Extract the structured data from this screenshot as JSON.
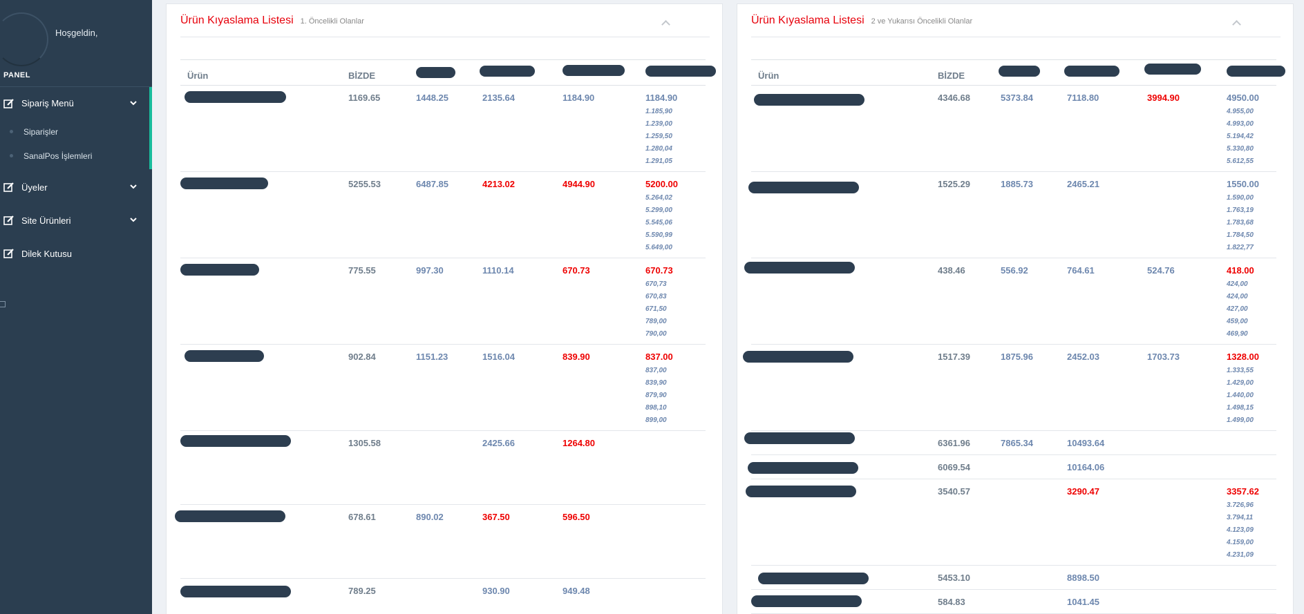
{
  "sidebar": {
    "welcome": "Hoşgeldin,",
    "panel_label": "PANEL",
    "menu": [
      {
        "label": "Sipariş Menü",
        "icon": "edit-icon",
        "has_chevron": true,
        "children": [
          "Siparişler",
          "SanalPos İşlemleri"
        ]
      },
      {
        "label": "Üyeler",
        "icon": "edit-icon",
        "has_chevron": true
      },
      {
        "label": "Site Ürünleri",
        "icon": "edit-icon",
        "has_chevron": true
      },
      {
        "label": "Dilek Kutusu",
        "icon": "edit-icon",
        "has_chevron": false
      }
    ]
  },
  "left_panel": {
    "title": "Ürün Kıyaslama Listesi",
    "subtitle": "1. Öncelikli Olanlar",
    "columns": [
      "Ürün",
      "BİZDE",
      "",
      "",
      "",
      ""
    ],
    "rows": [
      {
        "bizde": "1169.65",
        "c1": "1448.25",
        "c2": "2135.64",
        "c3": "1184.90",
        "c3_red": false,
        "c4": "1184.90",
        "c4_red": false,
        "offers": [
          "1.185,90",
          "1.239,00",
          "1.259,50",
          "1.280,04",
          "1.291,05"
        ]
      },
      {
        "bizde": "5255.53",
        "c1": "6487.85",
        "c2": "4213.02",
        "c2_red": true,
        "c3": "4944.90",
        "c3_red": true,
        "c4": "5200.00",
        "c4_red": true,
        "offers": [
          "5.264,02",
          "5.299,00",
          "5.545,06",
          "5.590,99",
          "5.649,00"
        ]
      },
      {
        "bizde": "775.55",
        "c1": "997.30",
        "c2": "1110.14",
        "c3": "670.73",
        "c3_red": true,
        "c4": "670.73",
        "c4_red": true,
        "offers": [
          "670,73",
          "670,83",
          "671,50",
          "789,00",
          "790,00"
        ]
      },
      {
        "bizde": "902.84",
        "c1": "1151.23",
        "c2": "1516.04",
        "c3": "839.90",
        "c3_red": true,
        "c4": "837.00",
        "c4_red": true,
        "offers": [
          "837,00",
          "839,90",
          "879,90",
          "898,10",
          "899,00"
        ]
      },
      {
        "bizde": "1305.58",
        "c1": "",
        "c2": "2425.66",
        "c3": "1264.80",
        "c3_red": true,
        "c4": "",
        "offers": []
      },
      {
        "bizde": "678.61",
        "c1": "890.02",
        "c2": "367.50",
        "c2_red": true,
        "c3": "596.50",
        "c3_red": true,
        "c4": "",
        "offers": []
      },
      {
        "bizde": "789.25",
        "c1": "",
        "c2": "930.90",
        "c3": "949.48",
        "c4": "",
        "offers": []
      }
    ]
  },
  "right_panel": {
    "title": "Ürün Kıyaslama Listesi",
    "subtitle": "2 ve Yukarısı Öncelikli Olanlar",
    "columns": [
      "Ürün",
      "BİZDE",
      "",
      "",
      "",
      ""
    ],
    "rows": [
      {
        "bizde": "4346.68",
        "c1": "5373.84",
        "c2": "7118.80",
        "c3": "3994.90",
        "c3_red": true,
        "c4": "4950.00",
        "offers": [
          "4.955,00",
          "4.993,00",
          "5.194,42",
          "5.330,80",
          "5.612,55"
        ]
      },
      {
        "bizde": "1525.29",
        "c1": "1885.73",
        "c2": "2465.21",
        "c3": "",
        "c4": "1550.00",
        "offers": [
          "1.590,00",
          "1.763,19",
          "1.783,68",
          "1.784,50",
          "1.822,77"
        ]
      },
      {
        "bizde": "438.46",
        "c1": "556.92",
        "c2": "764.61",
        "c3": "524.76",
        "c4": "418.00",
        "c4_red": true,
        "offers": [
          "424,00",
          "424,00",
          "427,00",
          "459,00",
          "469,90"
        ]
      },
      {
        "bizde": "1517.39",
        "c1": "1875.96",
        "c2": "2452.03",
        "c3": "1703.73",
        "c4": "1328.00",
        "c4_red": true,
        "offers": [
          "1.333,55",
          "1.429,00",
          "1.440,00",
          "1.498,15",
          "1.499,00"
        ]
      },
      {
        "bizde": "6361.96",
        "c1": "7865.34",
        "c2": "10493.64",
        "c3": "",
        "c4": "",
        "offers": []
      },
      {
        "bizde": "6069.54",
        "c1": "",
        "c2": "10164.06",
        "c3": "",
        "c4": "",
        "offers": []
      },
      {
        "bizde": "3540.57",
        "c1": "",
        "c2": "3290.47",
        "c2_red": true,
        "c3": "",
        "c4": "3357.62",
        "c4_red": true,
        "offers": [
          "3.726,96",
          "3.794,11",
          "4.123,09",
          "4.159,00",
          "4.231,09"
        ]
      },
      {
        "bizde": "5453.10",
        "c1": "",
        "c2": "8898.50",
        "c3": "",
        "c4": "",
        "offers": []
      },
      {
        "bizde": "584.83",
        "c1": "",
        "c2": "1041.45",
        "c3": "",
        "c4": "",
        "offers": []
      }
    ]
  },
  "colors": {
    "accent_red": "#e7000b",
    "sidebar_bg": "#2b3e50",
    "active_bar": "#1abc9c",
    "value_blue": "#6d87ae"
  }
}
